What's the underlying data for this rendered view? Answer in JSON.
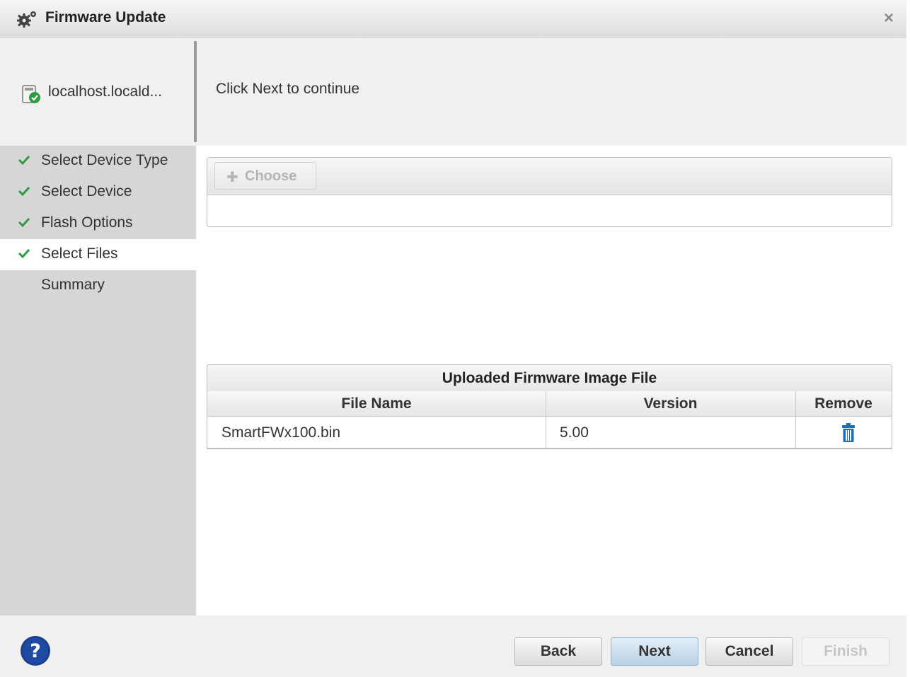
{
  "window": {
    "title": "Firmware Update",
    "title_icon": "gear-icon",
    "close_icon": "close-icon"
  },
  "device": {
    "label": "localhost.locald...",
    "icon": "device-ok-icon"
  },
  "instructions": "Click Next to continue",
  "steps": [
    {
      "label": "Select Device Type",
      "done": true,
      "active": false
    },
    {
      "label": "Select Device",
      "done": true,
      "active": false
    },
    {
      "label": "Flash Options",
      "done": true,
      "active": false
    },
    {
      "label": "Select Files",
      "done": true,
      "active": true
    },
    {
      "label": "Summary",
      "done": false,
      "active": false
    }
  ],
  "upload": {
    "choose_label": "Choose",
    "choose_icon": "plus-icon"
  },
  "table": {
    "caption": "Uploaded Firmware Image File",
    "headers": {
      "file_name": "File Name",
      "version": "Version",
      "remove": "Remove"
    },
    "rows": [
      {
        "file_name": "SmartFWx100.bin",
        "version": "5.00",
        "remove_icon": "trash-icon"
      }
    ]
  },
  "footer": {
    "help_icon": "help-icon",
    "back": "Back",
    "next": "Next",
    "cancel": "Cancel",
    "finish": "Finish"
  },
  "colors": {
    "check": "#2e9b3e",
    "help": "#1a3f8f",
    "trash": "#1e6fb8",
    "primary_button": "#b9d2e6"
  }
}
